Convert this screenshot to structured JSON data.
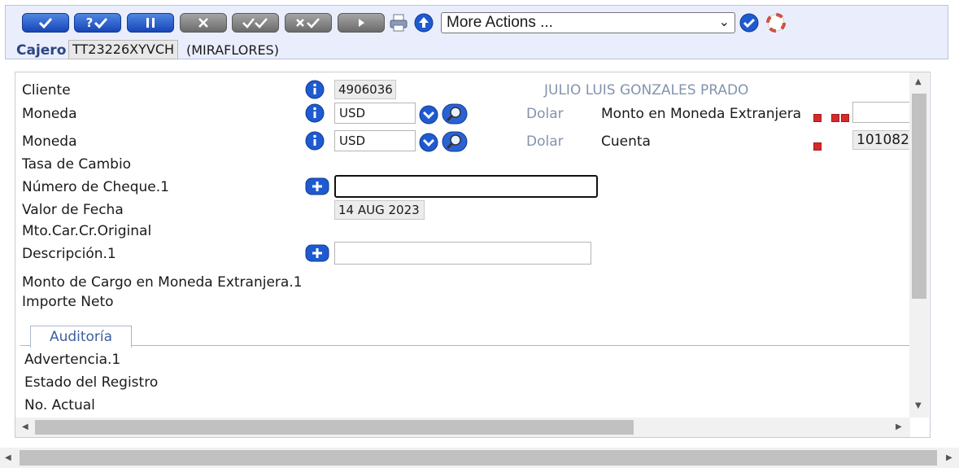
{
  "toolbar": {
    "buttons": [
      {
        "name": "commit-button",
        "symbol": "✔",
        "style": "blue"
      },
      {
        "name": "validate-button",
        "symbol": "?✔",
        "style": "blue"
      },
      {
        "name": "hold-button",
        "symbol": "❚❚",
        "style": "blue"
      },
      {
        "name": "delete-button",
        "symbol": "✕",
        "style": "gray"
      },
      {
        "name": "authorise-button",
        "symbol": "✔✔",
        "style": "gray"
      },
      {
        "name": "reverse-button",
        "symbol": "✕✔",
        "style": "gray"
      },
      {
        "name": "next-button",
        "symbol": "▶",
        "style": "gray"
      }
    ],
    "more_actions": "More Actions ...",
    "icons": [
      "printer-icon",
      "upload-icon",
      "go-check-icon",
      "help-lifebuoy-icon"
    ]
  },
  "header": {
    "cajero_label": "Cajero",
    "cajero_id": "TT23226XYVCH",
    "branch": "(MIRAFLORES)"
  },
  "form": {
    "cliente_label": "Cliente",
    "cliente_value": "4906036",
    "cliente_name": "JULIO LUIS GONZALES PRADO",
    "moneda1_label": "Moneda",
    "moneda1_value": "USD",
    "moneda1_desc": "Dolar",
    "monto_ext_label": "Monto en Moneda Extranjera",
    "moneda2_label": "Moneda",
    "moneda2_value": "USD",
    "moneda2_desc": "Dolar",
    "cuenta_label": "Cuenta",
    "cuenta_value": "101082",
    "tasa_label": "Tasa de Cambio",
    "cheque_label": "Número de Cheque.1",
    "cheque_value": "",
    "valor_fecha_label": "Valor de Fecha",
    "valor_fecha_value": "14 AUG 2023",
    "mto_car_label": "Mto.Car.Cr.Original",
    "descripcion_label": "Descripción.1",
    "descripcion_value": "",
    "monto_cargo_label": "Monto de Cargo en Moneda Extranjera.1",
    "importe_label": "Importe Neto"
  },
  "audit": {
    "tab_label": "Auditoría",
    "advertencia_label": "Advertencia.1",
    "estado_label": "Estado del Registro",
    "no_actual_label": "No. Actual"
  },
  "colors": {
    "toolbar_bg": "#eaeefc",
    "primary_button": "#1f55c8",
    "disabled_button": "#808080",
    "muted_text": "#8393ad",
    "required_marker": "#d62a2a"
  }
}
